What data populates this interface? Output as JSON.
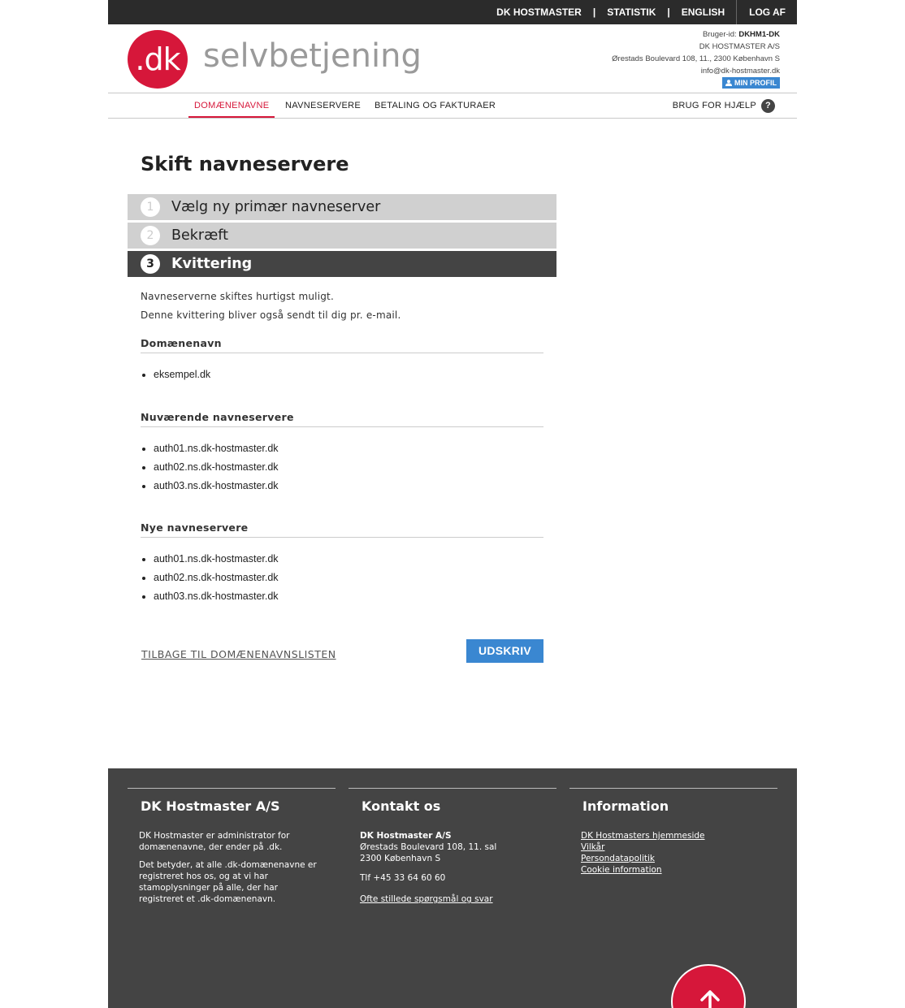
{
  "topbar": {
    "links": [
      "DK HOSTMASTER",
      "STATISTIK",
      "ENGLISH"
    ],
    "separator": "|",
    "logout": "LOG AF"
  },
  "header": {
    "logo_mark": ".dk",
    "logo_text": "selvbetjening",
    "user_id_label": "Bruger-id:",
    "user_id": "DKHM1-DK",
    "company": "DK HOSTMASTER A/S",
    "address": "Ørestads Boulevard 108, 11., 2300 København S",
    "email": "info@dk-hostmaster.dk",
    "profile_button": "MIN PROFIL"
  },
  "nav": {
    "items": [
      "DOMÆNENAVNE",
      "NAVNESERVERE",
      "BETALING OG FAKTURAER"
    ],
    "active_index": 0,
    "help": "BRUG FOR HJÆLP",
    "help_icon": "?"
  },
  "main": {
    "title": "Skift navneservere",
    "steps": [
      {
        "num": "1",
        "label": "Vælg ny primær navneserver",
        "state": "done"
      },
      {
        "num": "2",
        "label": "Bekræft",
        "state": "done"
      },
      {
        "num": "3",
        "label": "Kvittering",
        "state": "active"
      }
    ],
    "messages": [
      "Navneserverne skiftes hurtigst muligt.",
      "Denne kvittering bliver også sendt til dig pr. e-mail."
    ],
    "domain_title": "Domænenavn",
    "domains": [
      "eksempel.dk"
    ],
    "current_title": "Nuværende navneservere",
    "current_servers": [
      "auth01.ns.dk-hostmaster.dk",
      "auth02.ns.dk-hostmaster.dk",
      "auth03.ns.dk-hostmaster.dk"
    ],
    "new_title": "Nye navneservere",
    "new_servers": [
      "auth01.ns.dk-hostmaster.dk",
      "auth02.ns.dk-hostmaster.dk",
      "auth03.ns.dk-hostmaster.dk"
    ],
    "back_link": "TILBAGE TIL DOMÆNENAVNSLISTEN",
    "print_button": "UDSKRIV"
  },
  "footer": {
    "col1": {
      "title": "DK Hostmaster A/S",
      "p1": "DK Hostmaster er administrator for domænenavne, der ender på .dk.",
      "p2": "Det betyder, at alle .dk-domænenavne er registreret hos os, og at vi har stamoplysninger på alle, der har registreret et .dk-domænenavn."
    },
    "col2": {
      "title": "Kontakt os",
      "company": "DK Hostmaster A/S",
      "street": "Ørestads Boulevard 108, 11. sal",
      "city": "2300 København S",
      "phone": "Tlf +45 33 64 60 60",
      "faq": "Ofte stillede spørgsmål og svar"
    },
    "col3": {
      "title": "Information",
      "links": [
        "DK Hostmasters hjemmeside",
        "Vilkår",
        "Persondatapolitik",
        "Cookie information"
      ]
    }
  },
  "colors": {
    "brand_red": "#d6173a",
    "button_blue": "#3a87d1",
    "dark": "#444444"
  }
}
